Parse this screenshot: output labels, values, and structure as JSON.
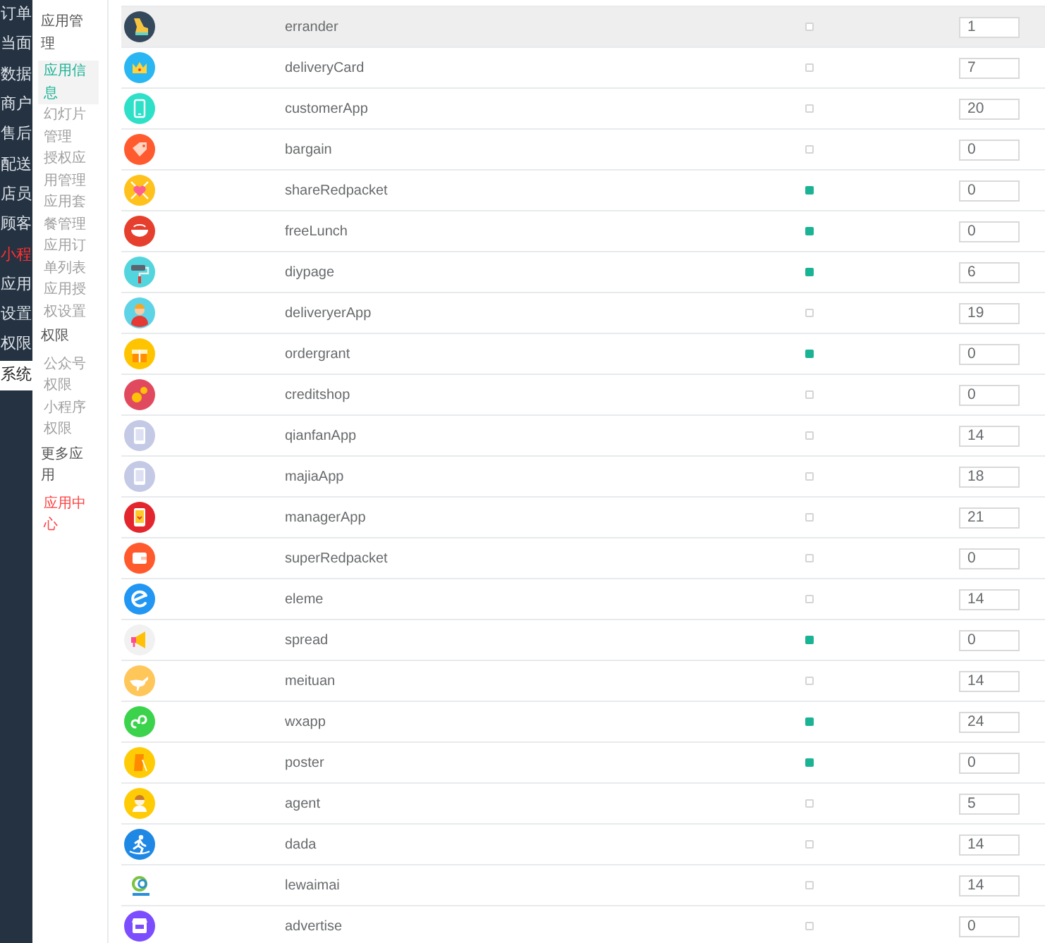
{
  "main_nav": {
    "items": [
      {
        "label": "订单",
        "selected": false,
        "highlighted": false
      },
      {
        "label": "当面",
        "selected": false,
        "highlighted": false
      },
      {
        "label": "数据",
        "selected": false,
        "highlighted": false
      },
      {
        "label": "商户",
        "selected": false,
        "highlighted": false
      },
      {
        "label": "售后",
        "selected": false,
        "highlighted": false
      },
      {
        "label": "配送",
        "selected": false,
        "highlighted": false
      },
      {
        "label": "店员",
        "selected": false,
        "highlighted": false
      },
      {
        "label": "顾客",
        "selected": false,
        "highlighted": false
      },
      {
        "label": "小程",
        "selected": false,
        "highlighted": true
      },
      {
        "label": "应用",
        "selected": false,
        "highlighted": false
      },
      {
        "label": "设置",
        "selected": false,
        "highlighted": false
      },
      {
        "label": "权限",
        "selected": false,
        "highlighted": false
      },
      {
        "label": "系统",
        "selected": true,
        "highlighted": false
      }
    ]
  },
  "sub_nav": {
    "sections": [
      {
        "title": "应用管理",
        "items": [
          {
            "label": "应用信息",
            "selected": true,
            "highlighted": false
          },
          {
            "label": "幻灯片管理",
            "selected": false,
            "highlighted": false
          },
          {
            "label": "授权应用管理",
            "selected": false,
            "highlighted": false
          },
          {
            "label": "应用套餐管理",
            "selected": false,
            "highlighted": false
          },
          {
            "label": "应用订单列表",
            "selected": false,
            "highlighted": false
          },
          {
            "label": "应用授权设置",
            "selected": false,
            "highlighted": false
          }
        ]
      },
      {
        "title": "权限",
        "items": [
          {
            "label": "公众号权限",
            "selected": false,
            "highlighted": false
          },
          {
            "label": "小程序权限",
            "selected": false,
            "highlighted": false
          }
        ]
      },
      {
        "title": "更多应用",
        "items": [
          {
            "label": "应用中心",
            "selected": false,
            "highlighted": true
          }
        ]
      }
    ]
  },
  "app_table": {
    "rows": [
      {
        "name": "errander",
        "checked": false,
        "value": "1",
        "hovered": true
      },
      {
        "name": "deliveryCard",
        "checked": false,
        "value": "7",
        "hovered": false
      },
      {
        "name": "customerApp",
        "checked": false,
        "value": "20",
        "hovered": false
      },
      {
        "name": "bargain",
        "checked": false,
        "value": "0",
        "hovered": false
      },
      {
        "name": "shareRedpacket",
        "checked": true,
        "value": "0",
        "hovered": false
      },
      {
        "name": "freeLunch",
        "checked": true,
        "value": "0",
        "hovered": false
      },
      {
        "name": "diypage",
        "checked": true,
        "value": "6",
        "hovered": false
      },
      {
        "name": "deliveryerApp",
        "checked": false,
        "value": "19",
        "hovered": false
      },
      {
        "name": "ordergrant",
        "checked": true,
        "value": "0",
        "hovered": false
      },
      {
        "name": "creditshop",
        "checked": false,
        "value": "0",
        "hovered": false
      },
      {
        "name": "qianfanApp",
        "checked": false,
        "value": "14",
        "hovered": false
      },
      {
        "name": "majiaApp",
        "checked": false,
        "value": "18",
        "hovered": false
      },
      {
        "name": "managerApp",
        "checked": false,
        "value": "21",
        "hovered": false
      },
      {
        "name": "superRedpacket",
        "checked": false,
        "value": "0",
        "hovered": false
      },
      {
        "name": "eleme",
        "checked": false,
        "value": "14",
        "hovered": false
      },
      {
        "name": "spread",
        "checked": true,
        "value": "0",
        "hovered": false
      },
      {
        "name": "meituan",
        "checked": false,
        "value": "14",
        "hovered": false
      },
      {
        "name": "wxapp",
        "checked": true,
        "value": "24",
        "hovered": false
      },
      {
        "name": "poster",
        "checked": true,
        "value": "0",
        "hovered": false
      },
      {
        "name": "agent",
        "checked": false,
        "value": "5",
        "hovered": false
      },
      {
        "name": "dada",
        "checked": false,
        "value": "14",
        "hovered": false
      },
      {
        "name": "lewaimai",
        "checked": false,
        "value": "14",
        "hovered": false
      },
      {
        "name": "advertise",
        "checked": false,
        "value": "0",
        "hovered": false
      }
    ]
  }
}
